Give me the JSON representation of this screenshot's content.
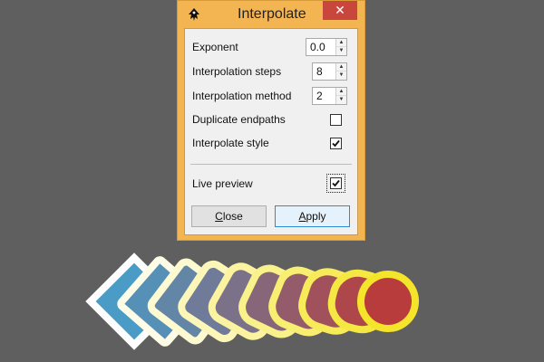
{
  "window": {
    "title": "Interpolate",
    "close_glyph": "✕",
    "app_icon": "inkscape-icon"
  },
  "fields": {
    "exponent": {
      "label": "Exponent",
      "value": "0.0"
    },
    "steps": {
      "label": "Interpolation steps",
      "value": "8"
    },
    "method": {
      "label": "Interpolation method",
      "value": "2"
    }
  },
  "checks": {
    "duplicate_endpaths": {
      "label": "Duplicate endpaths",
      "checked": false
    },
    "interpolate_style": {
      "label": "Interpolate style",
      "checked": true
    },
    "live_preview": {
      "label": "Live preview",
      "checked": true
    }
  },
  "buttons": {
    "close_first": "C",
    "close_rest": "lose",
    "apply_first": "A",
    "apply_rest": "pply"
  },
  "colors": {
    "canvas_bg": "#5f5f5f",
    "window_frame": "#f3b452",
    "close_red": "#c9463d",
    "start_fill": "#4a9bc6",
    "end_fill": "#b93c3c",
    "start_stroke": "#ffffff",
    "end_stroke": "#f5e52a"
  },
  "spin_glyphs": {
    "up": "▲",
    "down": "▼"
  }
}
